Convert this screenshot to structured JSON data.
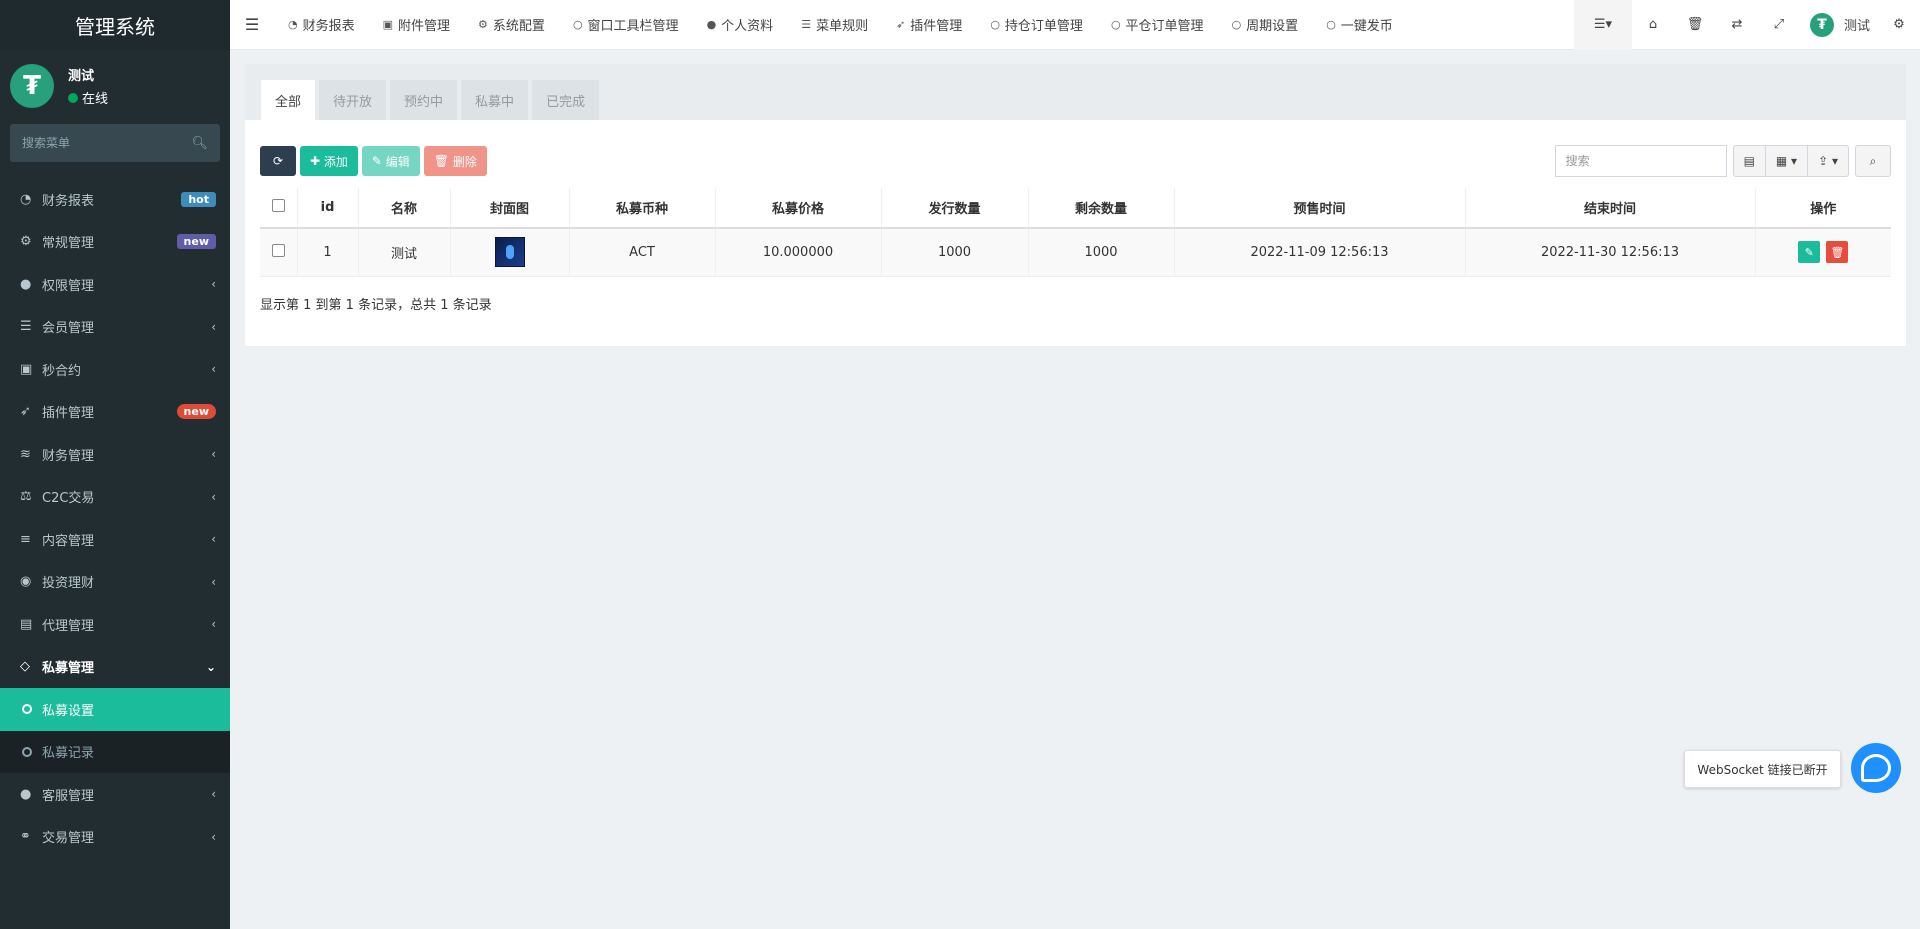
{
  "app": {
    "title": "管理系统"
  },
  "user": {
    "name": "测试",
    "status": "在线",
    "avatar_glyph": "₮"
  },
  "sidebar": {
    "search_placeholder": "搜索菜单",
    "items": [
      {
        "icon": "dashboard-icon",
        "label": "财务报表",
        "badge": "hot"
      },
      {
        "icon": "cogs-icon",
        "label": "常规管理",
        "badge": "new"
      },
      {
        "icon": "users-icon",
        "label": "权限管理"
      },
      {
        "icon": "list-icon",
        "label": "会员管理"
      },
      {
        "icon": "calendar-icon",
        "label": "秒合约"
      },
      {
        "icon": "rocket-icon",
        "label": "插件管理",
        "badge": "new"
      },
      {
        "icon": "database-icon",
        "label": "财务管理"
      },
      {
        "icon": "balance-icon",
        "label": "C2C交易"
      },
      {
        "icon": "align-icon",
        "label": "内容管理"
      },
      {
        "icon": "compass-icon",
        "label": "投资理财"
      },
      {
        "icon": "briefcase-icon",
        "label": "代理管理"
      },
      {
        "icon": "diamond-icon",
        "label": "私募管理"
      },
      {
        "icon": "comment-icon",
        "label": "客服管理"
      },
      {
        "icon": "handshake-icon",
        "label": "交易管理"
      }
    ],
    "submenu": [
      {
        "label": "私募设置"
      },
      {
        "label": "私募记录"
      }
    ]
  },
  "topnav": {
    "tabs": [
      {
        "icon": "dashboard-icon",
        "label": "财务报表"
      },
      {
        "icon": "file-image-icon",
        "label": "附件管理"
      },
      {
        "icon": "gear-icon",
        "label": "系统配置"
      },
      {
        "icon": "circle-icon",
        "label": "窗口工具栏管理"
      },
      {
        "icon": "user-icon",
        "label": "个人资料"
      },
      {
        "icon": "bars-icon",
        "label": "菜单规则"
      },
      {
        "icon": "rocket-icon",
        "label": "插件管理"
      },
      {
        "icon": "circle-icon",
        "label": "持仓订单管理"
      },
      {
        "icon": "circle-icon",
        "label": "平仓订单管理"
      },
      {
        "icon": "circle-icon",
        "label": "周期设置"
      },
      {
        "icon": "circle-icon",
        "label": "一键发币"
      }
    ],
    "username": "测试"
  },
  "panel": {
    "tabs": [
      "全部",
      "待开放",
      "预约中",
      "私募中",
      "已完成"
    ],
    "toolbar": {
      "add": "添加",
      "edit": "编辑",
      "delete": "删除",
      "search_placeholder": "搜索"
    },
    "table": {
      "headers": [
        "id",
        "名称",
        "封面图",
        "私募币种",
        "私募价格",
        "发行数量",
        "剩余数量",
        "预售时间",
        "结束时间",
        "操作"
      ],
      "rows": [
        {
          "id": "1",
          "name": "测试",
          "coin": "ACT",
          "price": "10.000000",
          "issued": "1000",
          "remaining": "1000",
          "presale": "2022-11-09 12:56:13",
          "end": "2022-11-30 12:56:13"
        }
      ]
    },
    "pager_info": "显示第 1 到第 1 条记录，总共 1 条记录"
  },
  "websocket": {
    "tip": "WebSocket 链接已断开"
  },
  "colors": {
    "sidebar_bg": "#222d32",
    "accent": "#1abc9c",
    "danger": "#e74c3c",
    "dark": "#2c3e50",
    "hot": "#3c8dbc",
    "new": "#605ca8"
  }
}
